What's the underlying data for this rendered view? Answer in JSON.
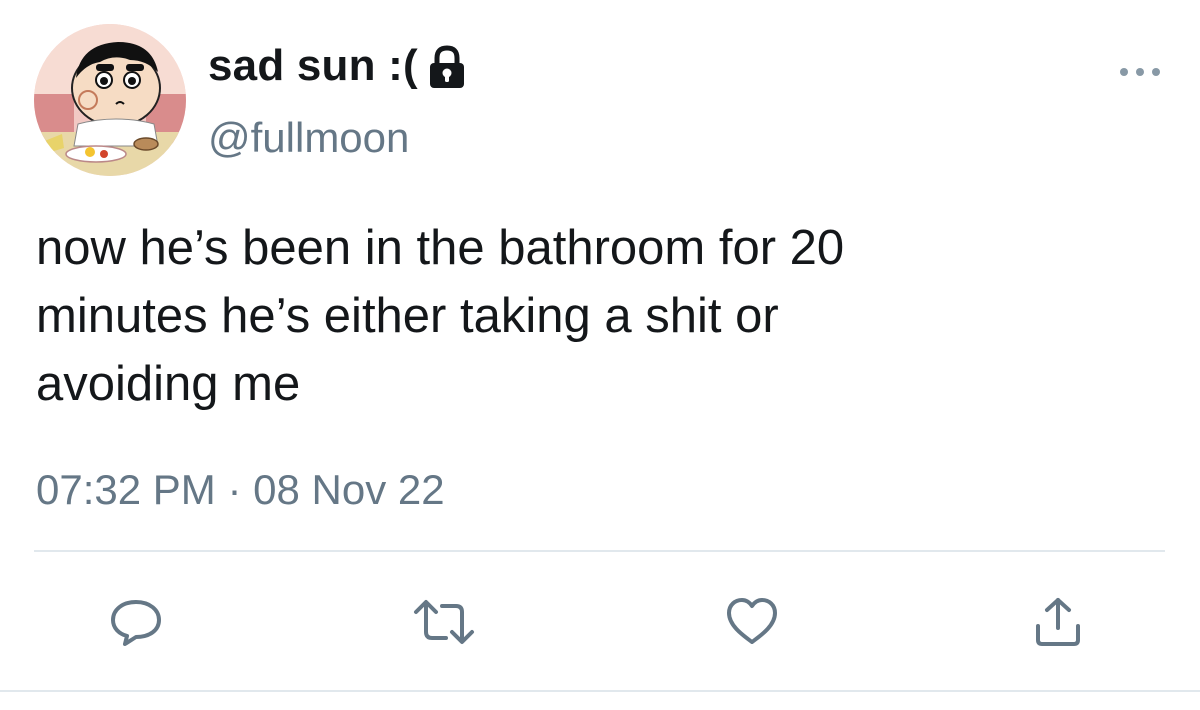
{
  "user": {
    "display_name": "sad sun :(",
    "handle": "@fullmoon",
    "avatar_icon": "cartoon-avatar-icon",
    "protected_icon": "lock-icon"
  },
  "tweet": {
    "text_lines": [
      "now he’s been in the bathroom for 20",
      "minutes he’s either taking a shit or",
      "avoiding me"
    ],
    "time": "07:32 PM",
    "separator": "·",
    "date": "08 Nov 22"
  },
  "actions": {
    "reply_icon": "reply-icon",
    "retweet_icon": "retweet-icon",
    "like_icon": "heart-icon",
    "share_icon": "share-icon",
    "more_icon": "more-options-icon"
  },
  "colors": {
    "text": "#14171a",
    "secondary": "#657786",
    "divider": "#e1e8ed",
    "icon": "#657786"
  }
}
